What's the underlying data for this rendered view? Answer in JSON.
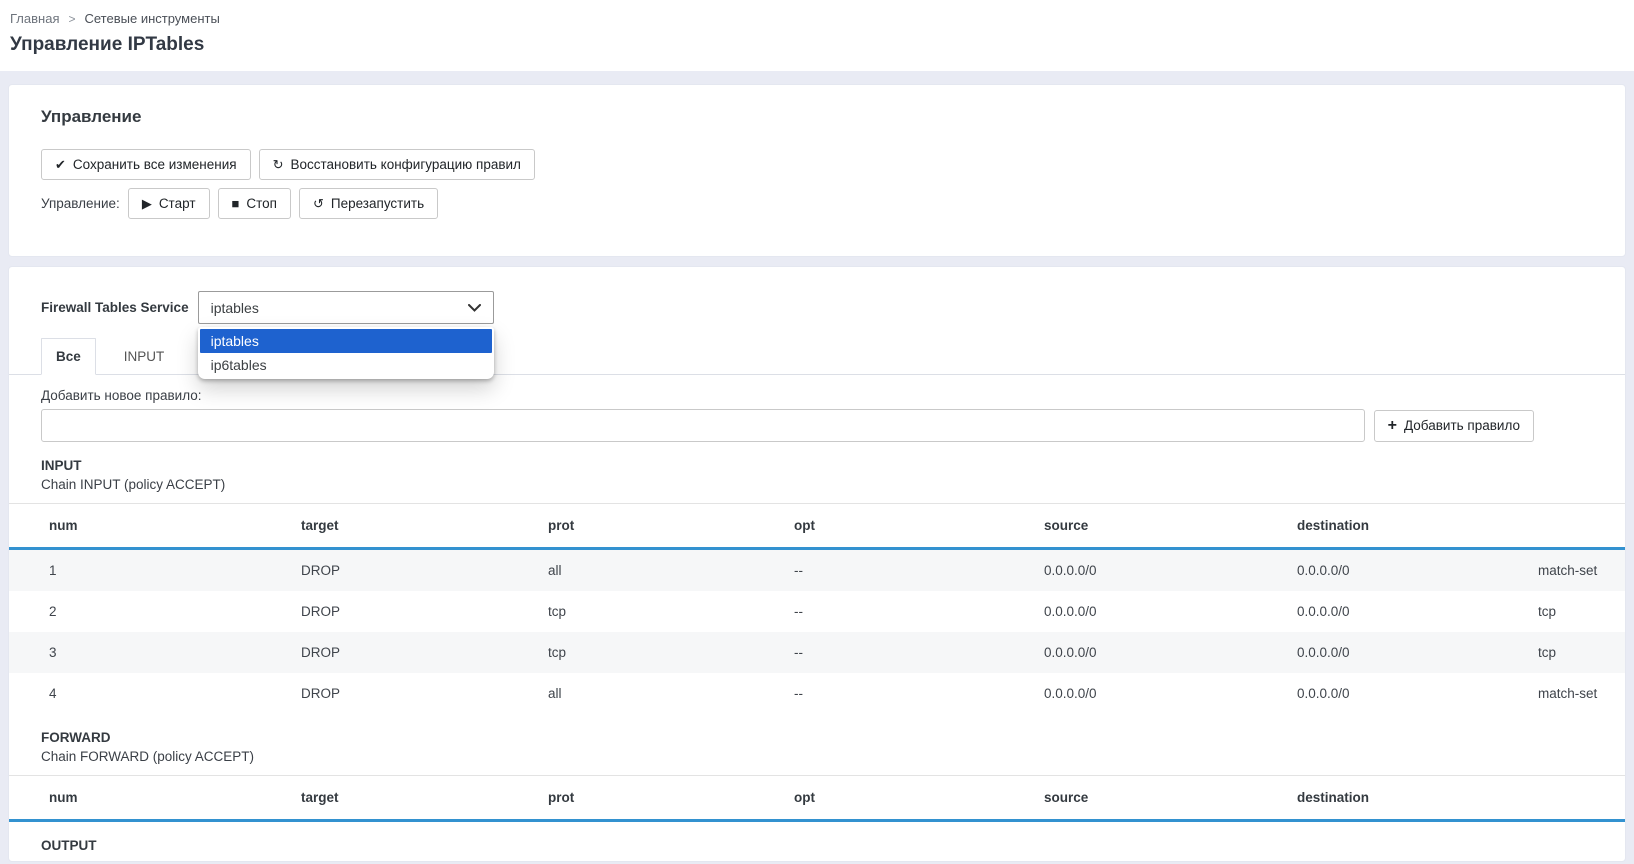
{
  "breadcrumb": {
    "home": "Главная",
    "separator": ">",
    "section": "Сетевые инструменты"
  },
  "page_title": "Управление IPTables",
  "icons": {
    "save": "✔",
    "restore": "↻",
    "start": "▶",
    "stop": "■",
    "restart": "↺",
    "add": "+"
  },
  "management": {
    "title": "Управление",
    "save_label": "Сохранить все изменения",
    "restore_label": "Восстановить конфигурацию правил",
    "control_label": "Управление:",
    "start_label": "Старт",
    "stop_label": "Стоп",
    "restart_label": "Перезапустить"
  },
  "firewall": {
    "service_label": "Firewall Tables Service",
    "selected": "iptables",
    "options": [
      {
        "label": "iptables",
        "selected": true
      },
      {
        "label": "ip6tables",
        "selected": false
      }
    ]
  },
  "tabs": [
    {
      "id": "all",
      "label": "Все",
      "active": true
    },
    {
      "id": "input",
      "label": "INPUT",
      "active": false
    }
  ],
  "add_rule": {
    "label": "Добавить новое правило:",
    "input_value": "",
    "button_label": "Добавить правило"
  },
  "chains": [
    {
      "name": "INPUT",
      "subtitle": "Chain INPUT (policy ACCEPT)",
      "columns": [
        "num",
        "target",
        "prot",
        "opt",
        "source",
        "destination",
        ""
      ],
      "rows": [
        [
          "1",
          "DROP",
          "all",
          "--",
          "0.0.0.0/0",
          "0.0.0.0/0",
          "match-set"
        ],
        [
          "2",
          "DROP",
          "tcp",
          "--",
          "0.0.0.0/0",
          "0.0.0.0/0",
          "tcp"
        ],
        [
          "3",
          "DROP",
          "tcp",
          "--",
          "0.0.0.0/0",
          "0.0.0.0/0",
          "tcp"
        ],
        [
          "4",
          "DROP",
          "all",
          "--",
          "0.0.0.0/0",
          "0.0.0.0/0",
          "match-set"
        ]
      ]
    },
    {
      "name": "FORWARD",
      "subtitle": "Chain FORWARD (policy ACCEPT)",
      "columns": [
        "num",
        "target",
        "prot",
        "opt",
        "source",
        "destination",
        ""
      ],
      "rows": []
    },
    {
      "name": "OUTPUT",
      "subtitle": "",
      "columns": [],
      "rows": []
    }
  ],
  "colors": {
    "page_background": "#e9ebf4",
    "accent_blue": "#3392d0",
    "dropdown_highlight": "#1e62cf"
  }
}
